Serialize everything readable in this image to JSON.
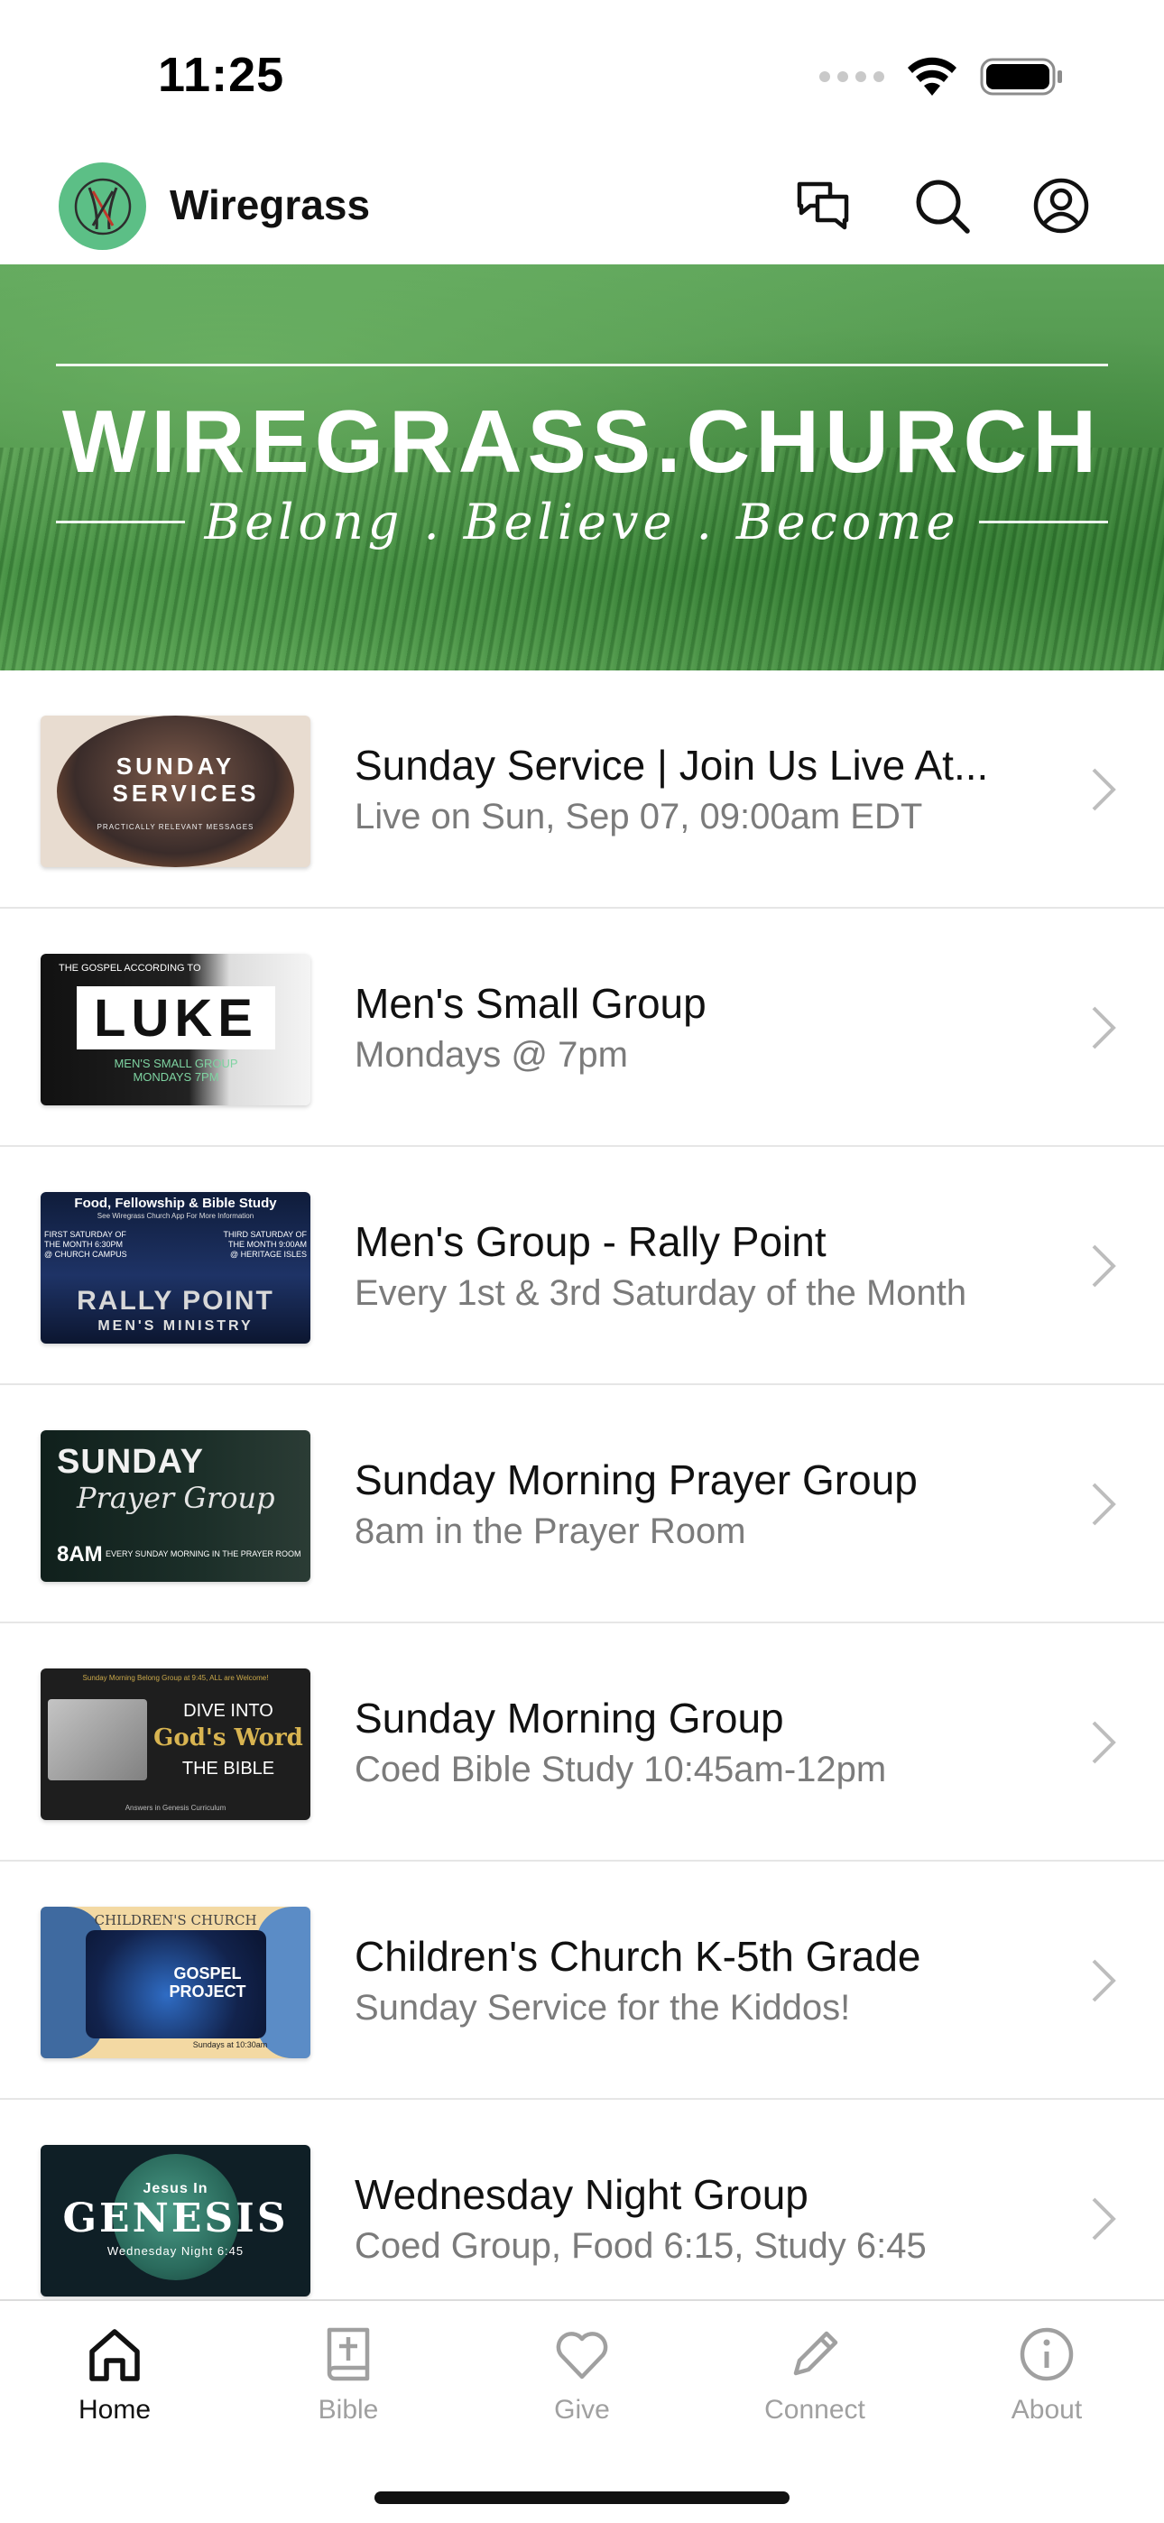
{
  "status_bar": {
    "time": "11:25"
  },
  "header": {
    "title": "Wiregrass",
    "icons": [
      "chat-icon",
      "search-icon",
      "account-icon"
    ]
  },
  "banner": {
    "title": "WIREGRASS.CHURCH",
    "tagline": "Belong . Believe . Become"
  },
  "list": [
    {
      "title": "Sunday Service | Join Us Live At...",
      "subtitle": "Live on Sun, Sep 07, 09:00am EDT",
      "thumb_text": "SUNDAY SERVICES",
      "thumb_small": "PRACTICALLY RELEVANT MESSAGES"
    },
    {
      "title": "Men's Small Group",
      "subtitle": "Mondays @ 7pm",
      "thumb_text": "LUKE",
      "thumb_top": "THE GOSPEL ACCORDING TO",
      "thumb_small": "MEN'S SMALL GROUP MONDAYS 7PM"
    },
    {
      "title": "Men's Group - Rally Point",
      "subtitle": "Every 1st & 3rd Saturday of the Month",
      "thumb_top": "Food, Fellowship & Bible Study",
      "thumb_sub": "See Wiregrass Church App For More Information",
      "thumb_left": "FIRST SATURDAY OF THE MONTH 6:30PM @ CHURCH CAMPUS",
      "thumb_right": "THIRD SATURDAY OF THE MONTH 9:00AM @ HERITAGE ISLES",
      "thumb_text": "RALLY POINT",
      "thumb_small": "MEN'S MINISTRY"
    },
    {
      "title": "Sunday Morning Prayer Group",
      "subtitle": "8am in the Prayer Room",
      "thumb_text": "SUNDAY",
      "thumb_script": "Prayer Group",
      "thumb_small": "8AM",
      "thumb_tiny": "EVERY SUNDAY MORNING IN THE PRAYER ROOM"
    },
    {
      "title": "Sunday Morning Group",
      "subtitle": "Coed Bible Study 10:45am-12pm",
      "thumb_top": "Sunday Morning Belong Group at 9:45, ALL are Welcome!",
      "thumb_line1": "DIVE INTO",
      "thumb_text": "God's Word",
      "thumb_line2": "THE BIBLE",
      "thumb_small": "Answers in Genesis Curriculum"
    },
    {
      "title": "Children's Church K-5th Grade",
      "subtitle": "Sunday Service for the Kiddos!",
      "thumb_top": "CHILDREN'S CHURCH",
      "thumb_text": "GOSPEL PROJECT",
      "thumb_small": "Sundays at 10:30am"
    },
    {
      "title": "Wednesday Night Group",
      "subtitle": "Coed Group, Food 6:15, Study 6:45",
      "thumb_top": "Jesus In",
      "thumb_text": "GENESIS",
      "thumb_small": "Wednesday Night 6:45"
    }
  ],
  "tabs": [
    {
      "label": "Home",
      "icon": "home-icon",
      "active": true
    },
    {
      "label": "Bible",
      "icon": "bible-icon",
      "active": false
    },
    {
      "label": "Give",
      "icon": "heart-icon",
      "active": false
    },
    {
      "label": "Connect",
      "icon": "pencil-icon",
      "active": false
    },
    {
      "label": "About",
      "icon": "info-icon",
      "active": false
    }
  ],
  "colors": {
    "brand_green": "#5cbf86",
    "banner_green": "#4c9148",
    "subtitle_gray": "#7b7b7b",
    "tab_inactive": "#a0a0a0"
  }
}
